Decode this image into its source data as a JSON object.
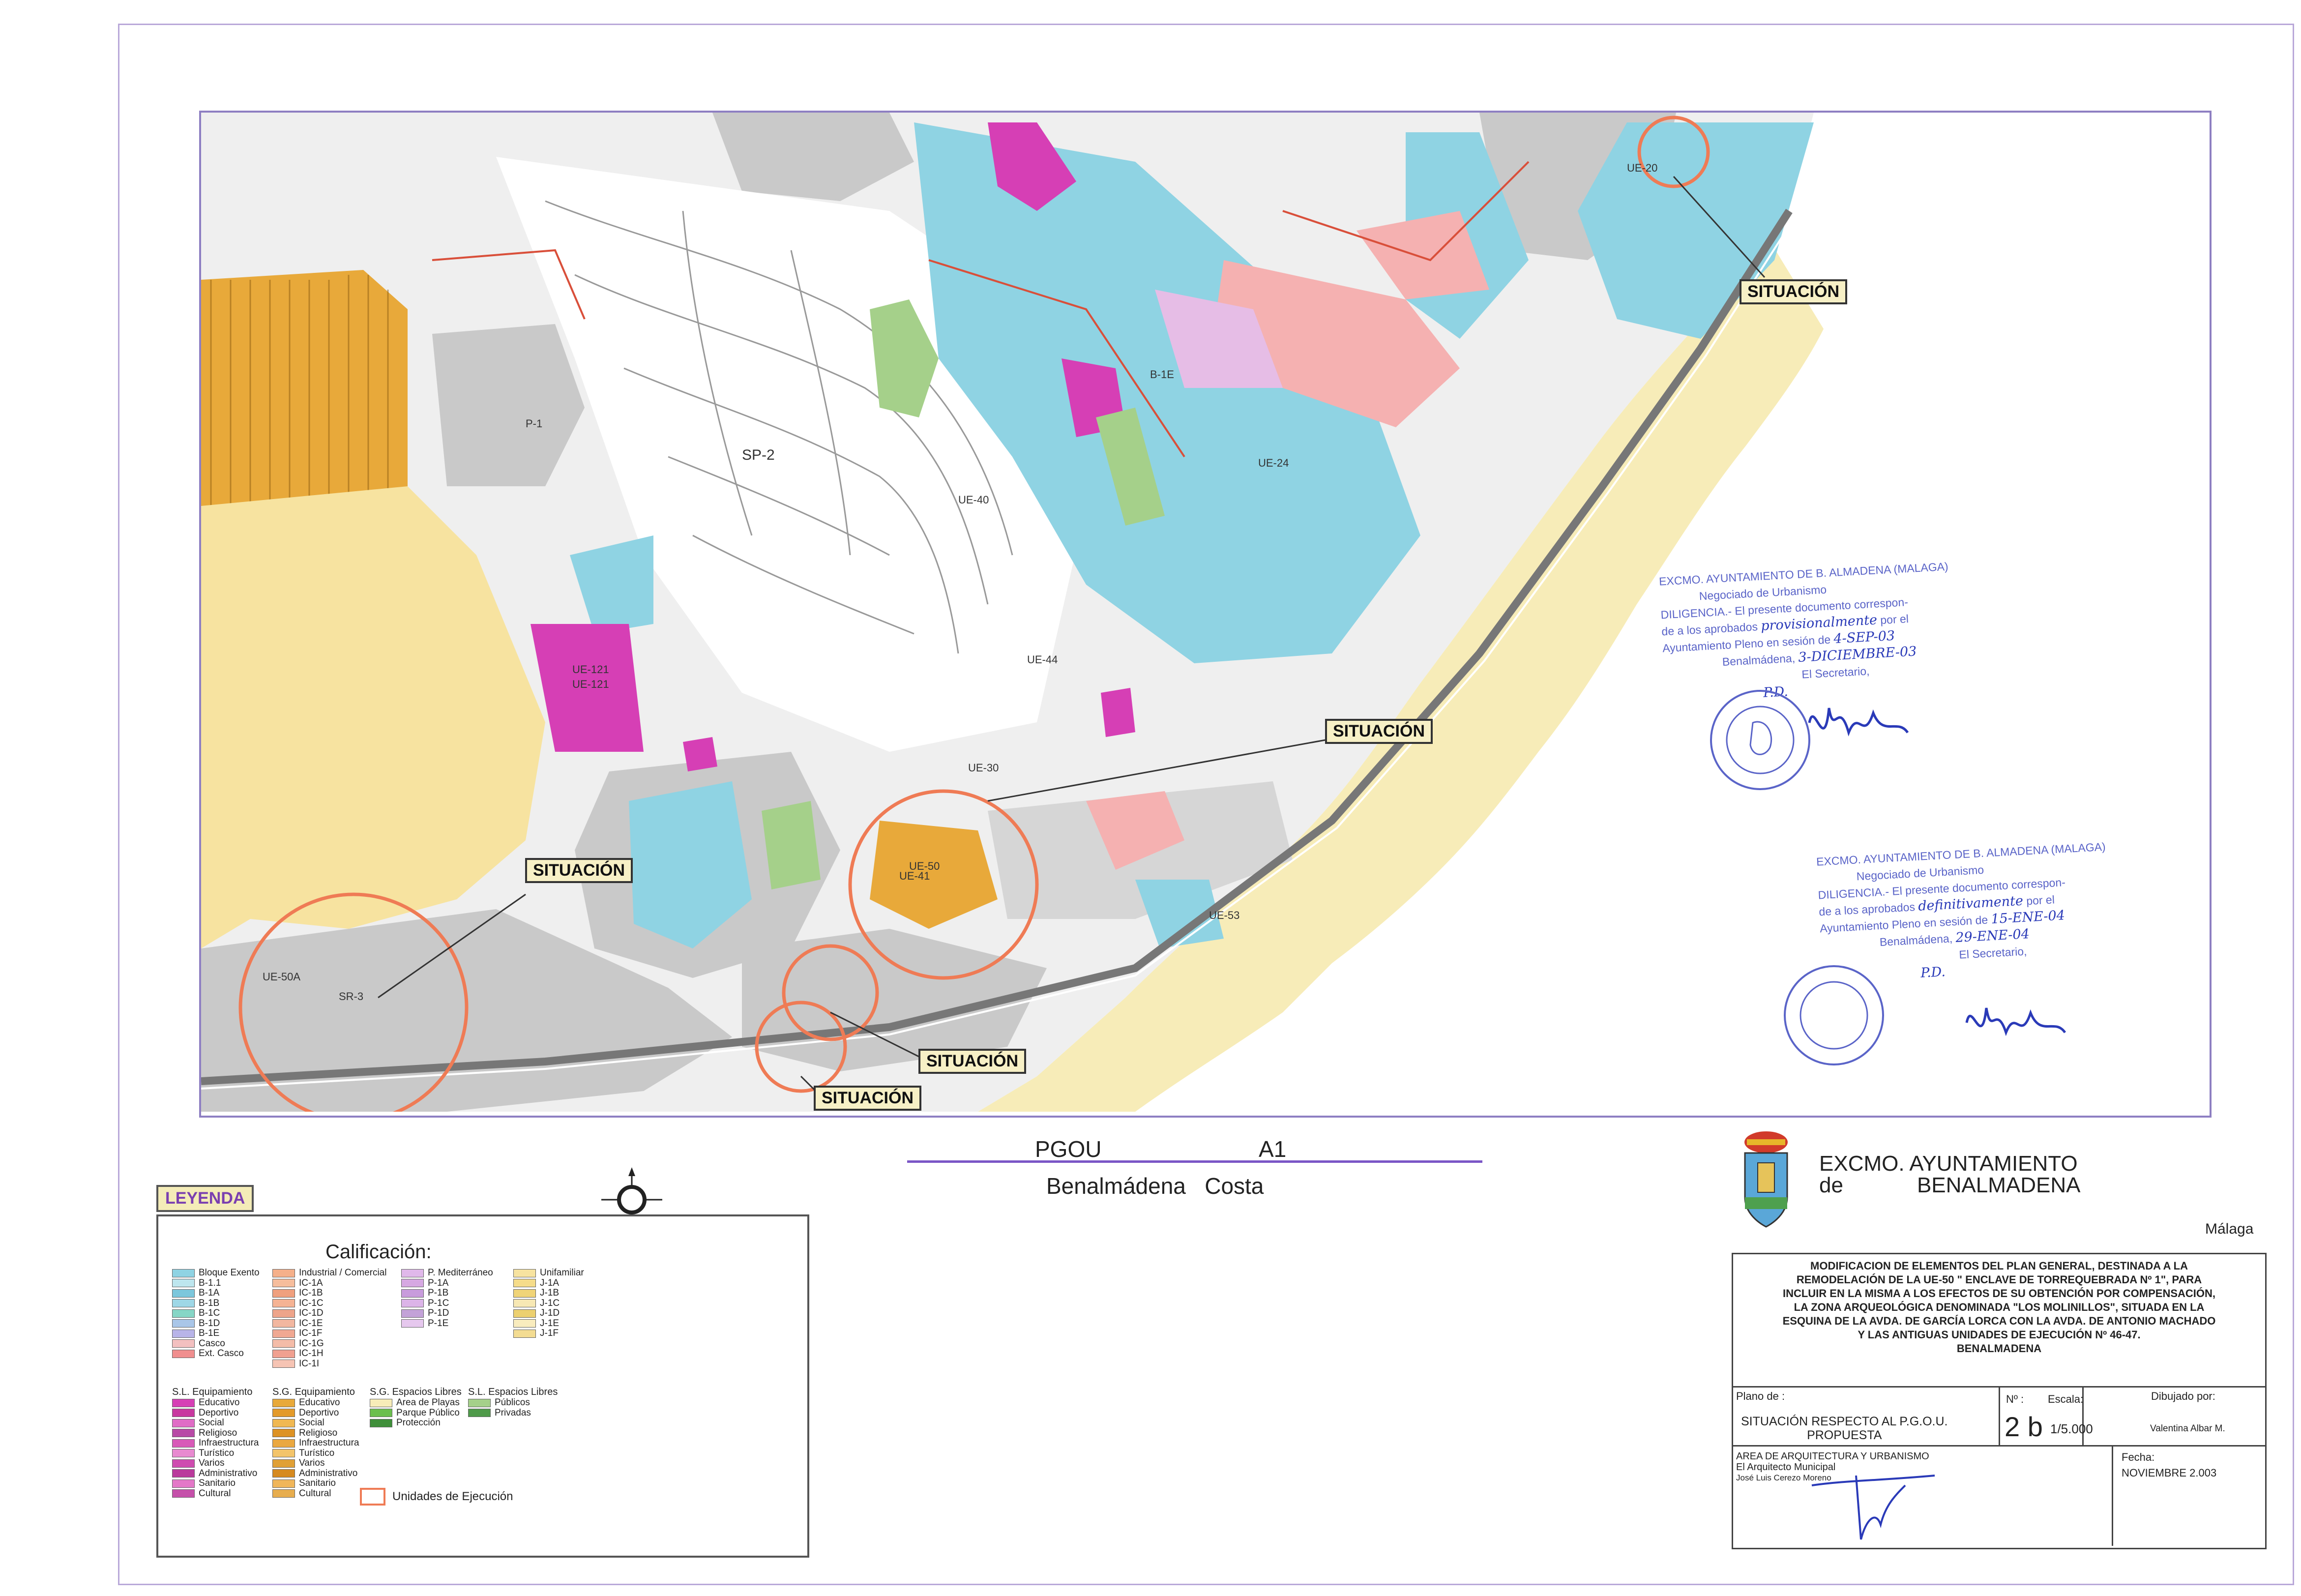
{
  "map": {
    "zone_labels": [
      "SP-2",
      "P-1",
      "UE-44",
      "UE-40",
      "UE-50",
      "UE-50A",
      "UE-121",
      "UE-121",
      "B-1E",
      "SR-3",
      "UE-20",
      "UE-24",
      "UE-41",
      "UE-53",
      "UE-30"
    ],
    "situacion_labels": [
      "SITUACIÓN",
      "SITUACIÓN",
      "SITUACIÓN",
      "SITUACIÓN",
      "SITUACIÓN"
    ]
  },
  "plan_title": {
    "pgou": "PGOU",
    "sheet": "A1",
    "place": "Benalmádena   Costa"
  },
  "legend": {
    "title": "LEYENDA",
    "calificacion": "Calificación:",
    "col1": [
      "Bloque Exento",
      "B-1.1",
      "B-1A",
      "B-1B",
      "B-1C",
      "B-1D",
      "B-1E",
      "Casco",
      "Ext. Casco"
    ],
    "col2": [
      "Industrial / Comercial",
      "IC-1A",
      "IC-1B",
      "IC-1C",
      "IC-1D",
      "IC-1E",
      "IC-1F",
      "IC-1G",
      "IC-1H",
      "IC-1I"
    ],
    "col3": [
      "P. Mediterráneo",
      "P-1A",
      "P-1B",
      "P-1C",
      "P-1D",
      "P-1E"
    ],
    "col4": [
      "Unifamiliar",
      "J-1A",
      "J-1B",
      "J-1C",
      "J-1D",
      "J-1E",
      "J-1F"
    ],
    "sl_eq_head": "S.L. Equipamiento",
    "sl_eq": [
      "Educativo",
      "Deportivo",
      "Social",
      "Religioso",
      "Infraestructura",
      "Turístico",
      "Varios",
      "Administrativo",
      "Sanitario",
      "Cultural"
    ],
    "sg_eq_head": "S.G. Equipamiento",
    "sg_eq": [
      "Educativo",
      "Deportivo",
      "Social",
      "Religioso",
      "Infraestructura",
      "Turístico",
      "Varios",
      "Administrativo",
      "Sanitario",
      "Cultural"
    ],
    "sg_el_head": "S.G. Espacios Libres",
    "sg_el": [
      "Area de Playas",
      "Parque Público",
      "Protección"
    ],
    "sl_el_head": "S.L. Espacios Libres",
    "sl_el": [
      "Públicos",
      "Privadas"
    ],
    "ue": "Unidades de Ejecución"
  },
  "colors": {
    "residential_blue": "#8fd3e3",
    "pink": "#f5b1b1",
    "magenta": "#d63fb5",
    "orange": "#e8a93a",
    "beach": "#f7ecb8",
    "gray": "#c9c9c9",
    "green": "#a5d08a",
    "situacion_circle": "#ef7b55",
    "frame": "#8e7fc2"
  },
  "stamps": {
    "s1_l1": "EXCMO. AYUNTAMIENTO DE B. ALMADENA (MALAGA)",
    "s1_l2": "Negociado de Urbanismo",
    "s1_l3": "DILIGENCIA.- El presente documento correspon-",
    "s1_l4": "de a los aprobados",
    "s1_hand1": "provisionalmente",
    "s1_l4b": "por el",
    "s1_l5": "Ayuntamiento Pleno en sesión de",
    "s1_hand2": "4-SEP-03",
    "s1_l6": "Benalmádena,",
    "s1_hand3": "3-DICIEMBRE-03",
    "s1_l7": "El Secretario,",
    "s1_pd": "P.D.",
    "s2_l1": "EXCMO. AYUNTAMIENTO DE B. ALMADENA (MALAGA)",
    "s2_l2": "Negociado de Urbanismo",
    "s2_l3": "DILIGENCIA.- El presente documento correspon-",
    "s2_l4": "de a los aprobados",
    "s2_hand1": "definitivamente",
    "s2_l4b": "por el",
    "s2_l5": "Ayuntamiento Pleno en sesión de",
    "s2_hand2": "15-ENE-04",
    "s2_l6": "Benalmádena,",
    "s2_hand3": "29-ENE-04",
    "s2_l7": "El Secretario,",
    "s2_pd": "P.D."
  },
  "org": {
    "line1": "EXCMO. AYUNTAMIENTO",
    "line2a": "de",
    "line2b": "BENALMADENA",
    "province": "Málaga"
  },
  "titleblock": {
    "description": [
      "MODIFICACION DE ELEMENTOS DEL PLAN GENERAL, DESTINADA A LA",
      "REMODELACIÓN DE LA UE-50 \" ENCLAVE DE TORREQUEBRADA Nº 1\", PARA",
      "INCLUIR EN LA MISMA A LOS EFECTOS DE SU OBTENCIÓN POR COMPENSACIÓN,",
      "LA ZONA ARQUEOLÓGICA DENOMINADA \"LOS MOLINILLOS\", SITUADA EN LA",
      "ESQUINA DE LA AVDA. DE GARCÍA LORCA CON LA AVDA. DE ANTONIO MACHADO",
      "Y LAS ANTIGUAS UNIDADES DE EJECUCIÓN Nº 46-47.",
      "BENALMADENA"
    ],
    "plano_label": "Plano de :",
    "plano_value": [
      "SITUACIÓN RESPECTO AL P.G.O.U.",
      "PROPUESTA"
    ],
    "num_label": "Nº :",
    "num_value": "2 b",
    "escala_label": "Escala:",
    "escala_value": "1/5.000",
    "dibujado_label": "Dibujado por:",
    "dibujado_value": "Valentina Albar M.",
    "area": [
      "AREA DE ARQUITECTURA Y URBANISMO",
      "El Arquitecto Municipal",
      "José Luis Cerezo Moreno"
    ],
    "fecha_label": "Fecha:",
    "fecha_value": "NOVIEMBRE 2.003"
  }
}
